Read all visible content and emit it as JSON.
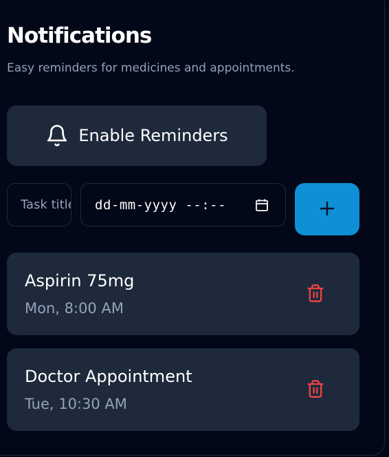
{
  "header": {
    "title": "Notifications",
    "subtitle": "Easy reminders for medicines and appointments."
  },
  "enable_button": {
    "label": "Enable Reminders",
    "icon": "bell-icon"
  },
  "form": {
    "task_placeholder": "Task title",
    "datetime_placeholder": "dd-mm-yyyy --:--",
    "calendar_icon": "calendar-icon",
    "add_icon": "plus-icon"
  },
  "reminders": [
    {
      "title": "Aspirin 75mg",
      "time": "Mon, 8:00 AM",
      "delete_icon": "trash-icon"
    },
    {
      "title": "Doctor Appointment",
      "time": "Tue, 10:30 AM",
      "delete_icon": "trash-icon"
    }
  ],
  "colors": {
    "background": "#020817",
    "card": "#1e293b",
    "accent": "#0f8fd6",
    "danger": "#ef4444",
    "muted_text": "#94a3b8"
  }
}
